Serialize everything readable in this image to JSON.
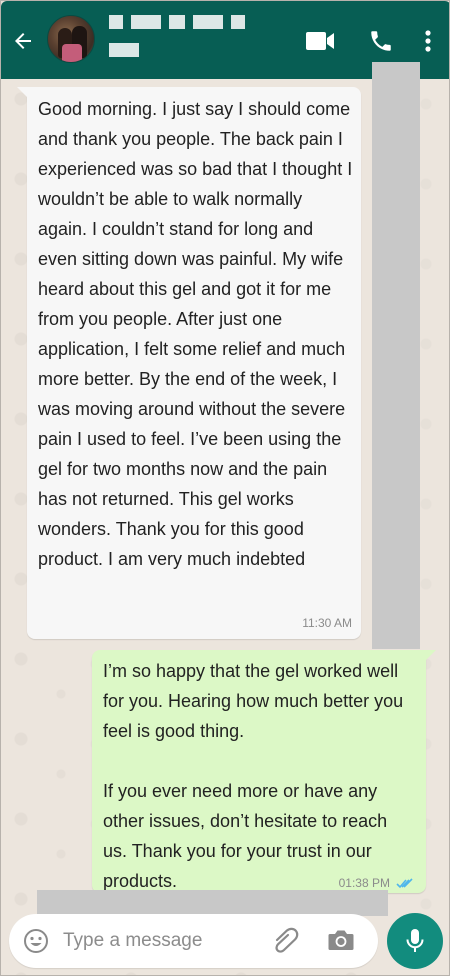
{
  "header": {
    "back_icon": "arrow-left-icon",
    "video_icon": "video-camera-icon",
    "call_icon": "phone-icon",
    "menu_icon": "more-vertical-icon"
  },
  "messages": [
    {
      "direction": "incoming",
      "text": "Good morning. I just say I should come and thank you people. The back pain I experienced was so bad that I thought I wouldn’t be able to walk normally again. I couldn’t stand for long and even sitting down was painful. My wife heard about this gel and got it for me from you people. After just one application, I felt some relief and much more better. By the end of the week, I was moving around without the severe pain I used to feel. I’ve been using the gel for two months now and the pain has not returned. This gel works wonders. Thank you for this good product. I am very much indebted",
      "time": "11:30 AM"
    },
    {
      "direction": "outgoing",
      "text": "I’m so happy that the gel worked well for you. Hearing how much better you feel is good thing.\n\nIf you ever need more or have any other issues, don’t hesitate to reach us. Thank you for your trust in our products.",
      "time": "01:38 PM",
      "status_icon": "double-check-icon"
    }
  ],
  "composer": {
    "placeholder": "Type a message",
    "emoji_icon": "emoji-icon",
    "attach_icon": "paperclip-icon",
    "camera_icon": "camera-icon",
    "mic_icon": "microphone-icon"
  },
  "colors": {
    "header_bg": "#075e54",
    "outgoing_bubble": "#dcf8c6",
    "incoming_bubble": "#f7f7f7",
    "mic_button": "#128c7e",
    "read_ticks": "#4fb6ec"
  }
}
